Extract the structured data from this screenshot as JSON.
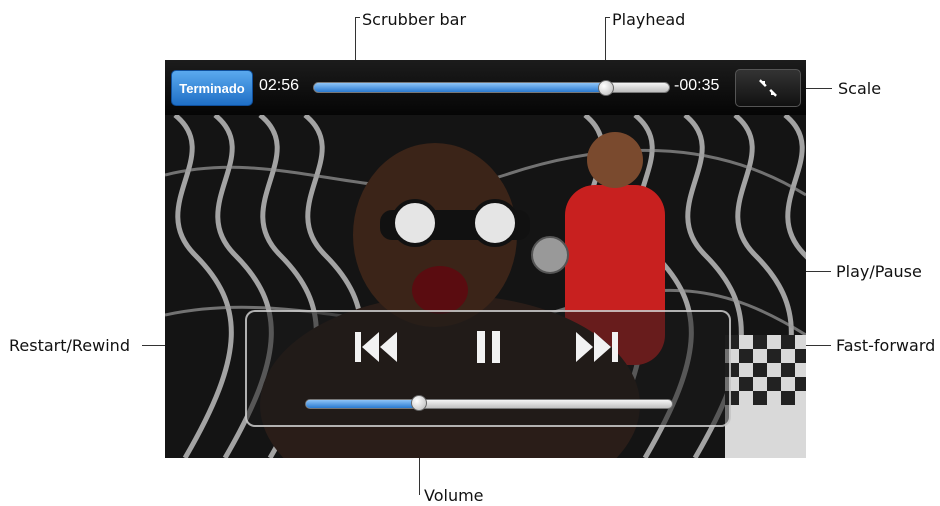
{
  "player": {
    "done_label": "Terminado",
    "elapsed": "02:56",
    "remaining": "-00:35",
    "playback_progress": 0.82,
    "volume_level": 0.31
  },
  "callouts": {
    "scrubber": "Scrubber bar",
    "playhead": "Playhead",
    "scale": "Scale",
    "play_pause": "Play/Pause",
    "rewind": "Restart/Rewind",
    "fast_forward": "Fast-forward",
    "volume": "Volume"
  },
  "icons": {
    "scale": "scale-icon",
    "rewind": "rewind-icon",
    "pause": "pause-icon",
    "fast_forward": "fast-forward-icon"
  },
  "colors": {
    "accent_blue": "#2a7ad0",
    "done_button": "#1f6fc6"
  }
}
